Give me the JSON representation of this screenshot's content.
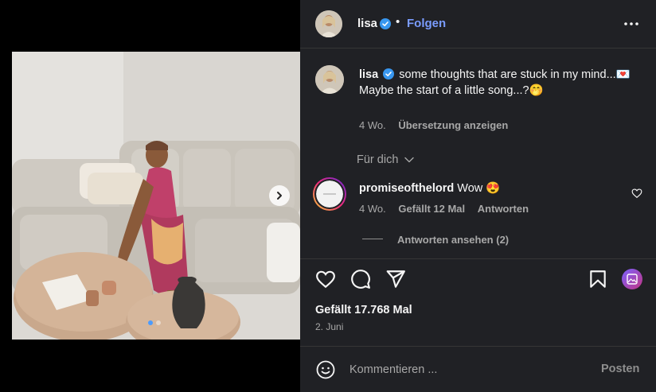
{
  "post": {
    "username": "lisa",
    "verified": true,
    "separator": "•",
    "follow_label": "Folgen",
    "carousel": {
      "slides": 2,
      "active_slide": 1
    }
  },
  "caption": {
    "username": "lisa",
    "line1": "some thoughts that are stuck in my mind...💌",
    "line2": "Maybe the start of a little song...?🤭",
    "age": "4 Wo.",
    "translate_label": "Übersetzung anzeigen"
  },
  "for_you_label": "Für dich",
  "comment": {
    "username": "promiseofthelord",
    "text": "Wow 😍",
    "age": "4 Wo.",
    "likes": "Gefällt 12 Mal",
    "reply_label": "Antworten",
    "view_replies": "Antworten ansehen (2)"
  },
  "stats": {
    "likes": "Gefällt 17.768 Mal",
    "date": "2. Juni"
  },
  "composer": {
    "placeholder": "Kommentieren ...",
    "post_label": "Posten"
  },
  "colors": {
    "panel_bg": "#202125",
    "link_blue": "#7a9cff",
    "verified_blue": "#3897f0",
    "muted": "#a8a8a8"
  },
  "icons": [
    "chevron-right-icon",
    "verified-icon",
    "more-icon",
    "chevron-down-icon",
    "heart-icon",
    "comment-icon",
    "share-icon",
    "bookmark-icon",
    "reels-icon",
    "emoji-icon"
  ]
}
